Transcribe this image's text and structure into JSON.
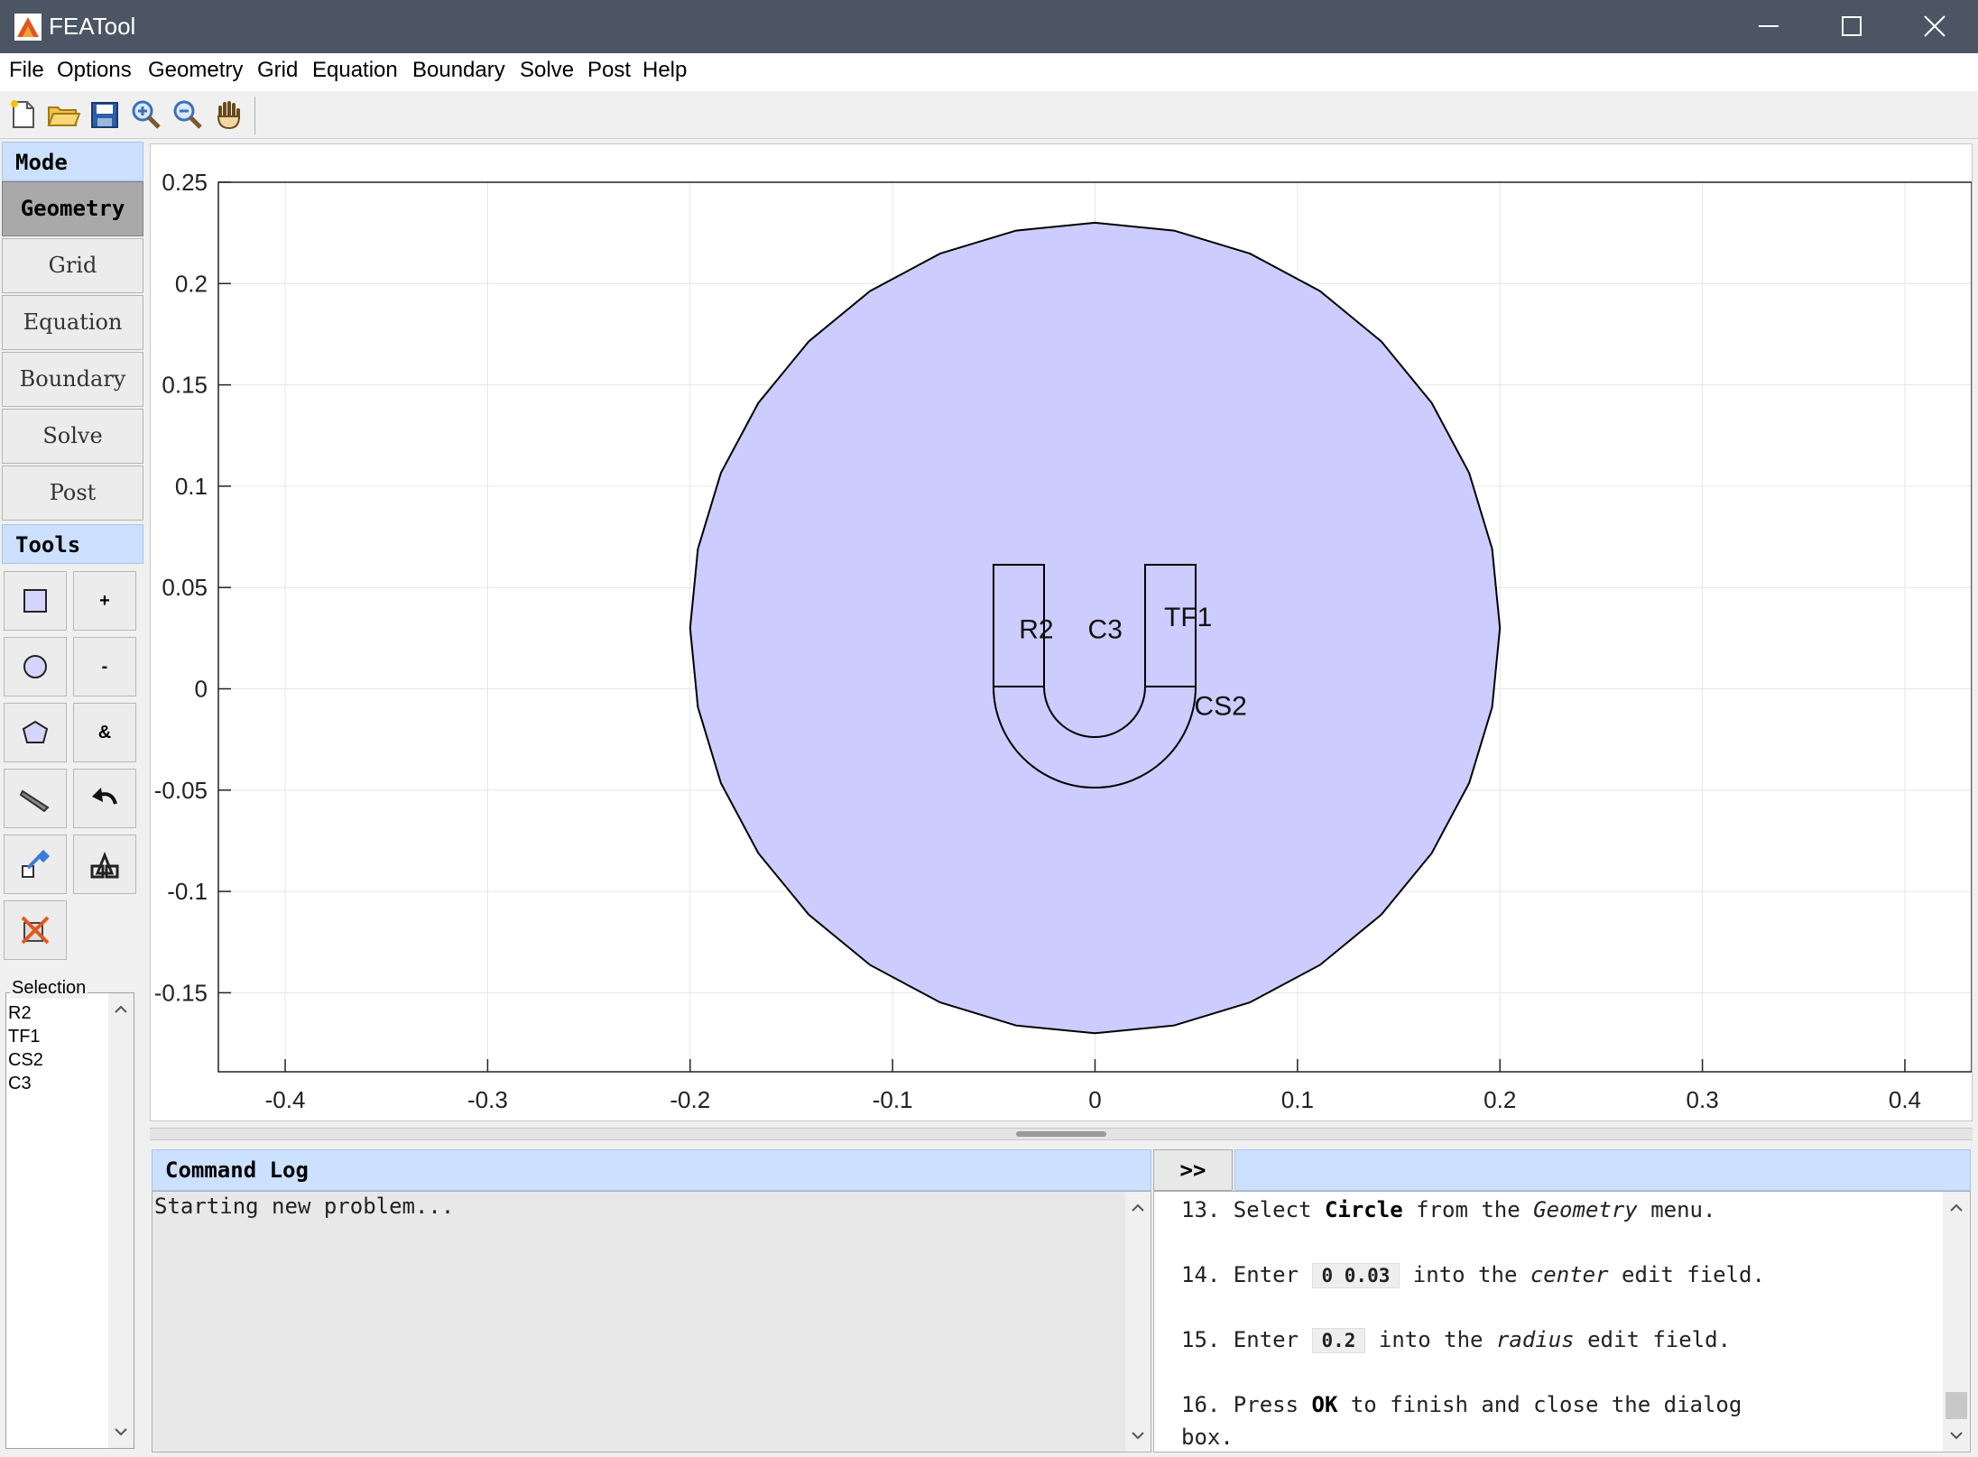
{
  "window": {
    "title": "FEATool"
  },
  "menu": [
    "File",
    "Options",
    "Geometry",
    "Grid",
    "Equation",
    "Boundary",
    "Solve",
    "Post",
    "Help"
  ],
  "toolbar_icons": [
    "new-file-icon",
    "open-folder-icon",
    "save-disk-icon",
    "zoom-in-icon",
    "zoom-out-icon",
    "pan-hand-icon"
  ],
  "mode": {
    "header": "Mode",
    "buttons": [
      "Geometry",
      "Grid",
      "Equation",
      "Boundary",
      "Solve",
      "Post"
    ],
    "active": "Geometry"
  },
  "tools": {
    "header": "Tools",
    "buttons": [
      {
        "name": "rectangle-tool-icon",
        "glyph": ""
      },
      {
        "name": "union-tool-button",
        "glyph": "+"
      },
      {
        "name": "circle-tool-icon",
        "glyph": ""
      },
      {
        "name": "subtract-tool-button",
        "glyph": "-"
      },
      {
        "name": "polygon-tool-icon",
        "glyph": ""
      },
      {
        "name": "intersect-tool-button",
        "glyph": "&"
      },
      {
        "name": "pen-tool-icon",
        "glyph": ""
      },
      {
        "name": "undo-tool-icon",
        "glyph": ""
      },
      {
        "name": "transform-tool-icon",
        "glyph": ""
      },
      {
        "name": "split-tool-icon",
        "glyph": ""
      },
      {
        "name": "delete-tool-icon",
        "glyph": ""
      }
    ]
  },
  "selection": {
    "label": "Selection",
    "items": [
      "R2",
      "TF1",
      "CS2",
      "C3"
    ]
  },
  "plot": {
    "x_ticks": [
      "-0.4",
      "-0.3",
      "-0.2",
      "-0.1",
      "0",
      "0.1",
      "0.2",
      "0.3",
      "0.4"
    ],
    "y_ticks": [
      "0.25",
      "0.2",
      "0.15",
      "0.1",
      "0.05",
      "0",
      "-0.05",
      "-0.1",
      "-0.15"
    ],
    "xlim": [
      -0.433,
      0.433
    ],
    "ylim": [
      -0.189,
      0.25
    ],
    "circle": {
      "center": [
        0,
        0.03
      ],
      "radius": 0.2,
      "fill": "#ccccff",
      "edge": "#000000"
    },
    "labels": [
      {
        "text": "R2",
        "x": -0.029,
        "y": 0.025
      },
      {
        "text": "C3",
        "x": 0.005,
        "y": 0.025
      },
      {
        "text": "TF1",
        "x": 0.046,
        "y": 0.031
      },
      {
        "text": "CS2",
        "x": 0.062,
        "y": -0.013
      }
    ]
  },
  "command_log": {
    "header": "Command Log",
    "expand_label": ">>",
    "lines": [
      "Starting new problem..."
    ]
  },
  "help": {
    "steps": [
      {
        "num": "13.",
        "parts": [
          [
            "t",
            "Select "
          ],
          [
            "b",
            "Circle"
          ],
          [
            "t",
            " from the "
          ],
          [
            "i",
            "Geometry"
          ],
          [
            "t",
            " menu."
          ]
        ]
      },
      {
        "num": "14.",
        "parts": [
          [
            "t",
            "Enter "
          ],
          [
            "c",
            "0 0.03"
          ],
          [
            "t",
            " into the "
          ],
          [
            "i",
            "center"
          ],
          [
            "t",
            " edit field."
          ]
        ]
      },
      {
        "num": "15.",
        "parts": [
          [
            "t",
            "Enter "
          ],
          [
            "c",
            "0.2"
          ],
          [
            "t",
            " into the "
          ],
          [
            "i",
            "radius"
          ],
          [
            "t",
            " edit field."
          ]
        ]
      },
      {
        "num": "16.",
        "parts": [
          [
            "t",
            "Press "
          ],
          [
            "b",
            "OK"
          ],
          [
            "t",
            " to finish and close the dialog"
          ]
        ],
        "cont": "box."
      }
    ]
  },
  "colors": {
    "titlebar": "#4b5563",
    "panel_header": "#cce0ff",
    "geometry_fill": "#ccccff"
  }
}
